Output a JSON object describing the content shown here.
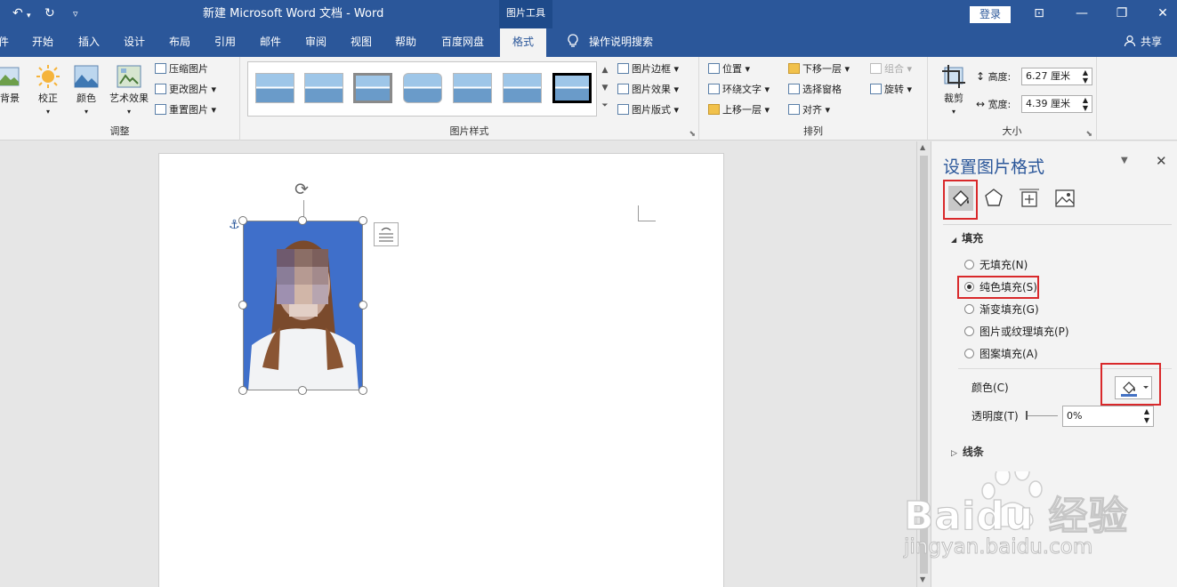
{
  "titlebar": {
    "title": "新建 Microsoft Word 文档  -  Word",
    "context_group": "图片工具",
    "login_label": "登录",
    "undo_icon": "↶",
    "redo_icon": "↻",
    "customize_icon": "▿",
    "ribbon_display_icon": "⊡",
    "minimize_icon": "—",
    "restore_icon": "❐",
    "close_icon": "✕"
  },
  "tabs": [
    {
      "label": "件"
    },
    {
      "label": "开始"
    },
    {
      "label": "插入"
    },
    {
      "label": "设计"
    },
    {
      "label": "布局"
    },
    {
      "label": "引用"
    },
    {
      "label": "邮件"
    },
    {
      "label": "审阅"
    },
    {
      "label": "视图"
    },
    {
      "label": "帮助"
    },
    {
      "label": "百度网盘"
    },
    {
      "label": "格式"
    }
  ],
  "tell_me": "操作说明搜索",
  "share": "共享",
  "ribbon": {
    "adjust": {
      "label": "调整",
      "remove_bg": "背景",
      "corrections": "校正",
      "color": "颜色",
      "artistic": "艺术效果",
      "compress": "压缩图片",
      "change": "更改图片",
      "reset": "重置图片"
    },
    "styles": {
      "label": "图片样式",
      "border": "图片边框",
      "effects": "图片效果",
      "layout": "图片版式"
    },
    "arrange": {
      "label": "排列",
      "position": "位置",
      "wrap": "环绕文字",
      "forward": "上移一层",
      "backward": "下移一层",
      "selection": "选择窗格",
      "align": "对齐",
      "group": "组合",
      "rotate": "旋转"
    },
    "size": {
      "label": "大小",
      "crop": "裁剪",
      "height_label": "高度:",
      "height_value": "6.27 厘米",
      "width_label": "宽度:",
      "width_value": "4.39 厘米"
    }
  },
  "pane": {
    "title": "设置图片格式",
    "tab_icons": [
      "fill-line-icon",
      "effects-icon",
      "layout-properties-icon",
      "picture-icon"
    ],
    "fill_section": "填充",
    "options": [
      {
        "label": "无填充(N)",
        "checked": false
      },
      {
        "label": "纯色填充(S)",
        "checked": true
      },
      {
        "label": "渐变填充(G)",
        "checked": false
      },
      {
        "label": "图片或纹理填充(P)",
        "checked": false
      },
      {
        "label": "图案填充(A)",
        "checked": false
      }
    ],
    "color_label": "颜色(C)",
    "transparency_label": "透明度(T)",
    "transparency_value": "0%",
    "line_section": "线条"
  },
  "watermark": {
    "text": "Baidu 经验",
    "url": "jingyan.baidu.com"
  },
  "colors": {
    "accent": "#2b579a",
    "highlight": "#d9292b",
    "photo_bg": "#3f6fca"
  }
}
